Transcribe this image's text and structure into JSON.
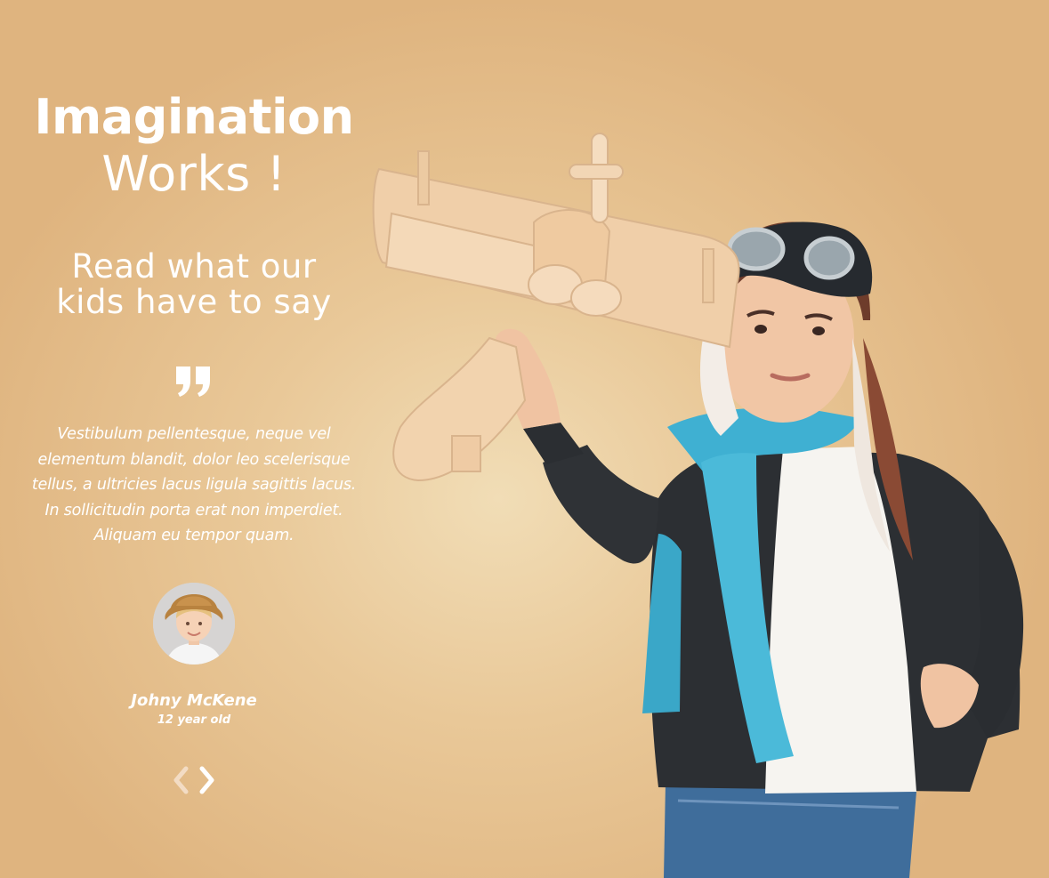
{
  "header": {
    "title_bold": "Imagination",
    "title_light": "Works !"
  },
  "intro": {
    "line1": "Read what our",
    "line2": "kids have to say"
  },
  "testimonial": {
    "quote_lines": [
      "Vestibulum pellentesque, neque vel",
      "elementum blandit, dolor leo scelerisque",
      "tellus, a ultricies lacus ligula sagittis lacus.",
      "In sollicitudin porta erat non imperdiet.",
      "Aliquam eu tempor quam."
    ],
    "author_name": "Johny McKene",
    "author_age": "12 year old"
  },
  "navigation": {
    "prev_icon": "chevron-left-icon",
    "next_icon": "chevron-right-icon"
  },
  "colors": {
    "background": "#e9c898",
    "text": "#ffffff",
    "arrow_prev": "#f3dcc4",
    "arrow_next": "#ffffff",
    "scarf": "#3fb0d2",
    "jacket": "#2c2f33",
    "wood": "#f0cfa9"
  }
}
